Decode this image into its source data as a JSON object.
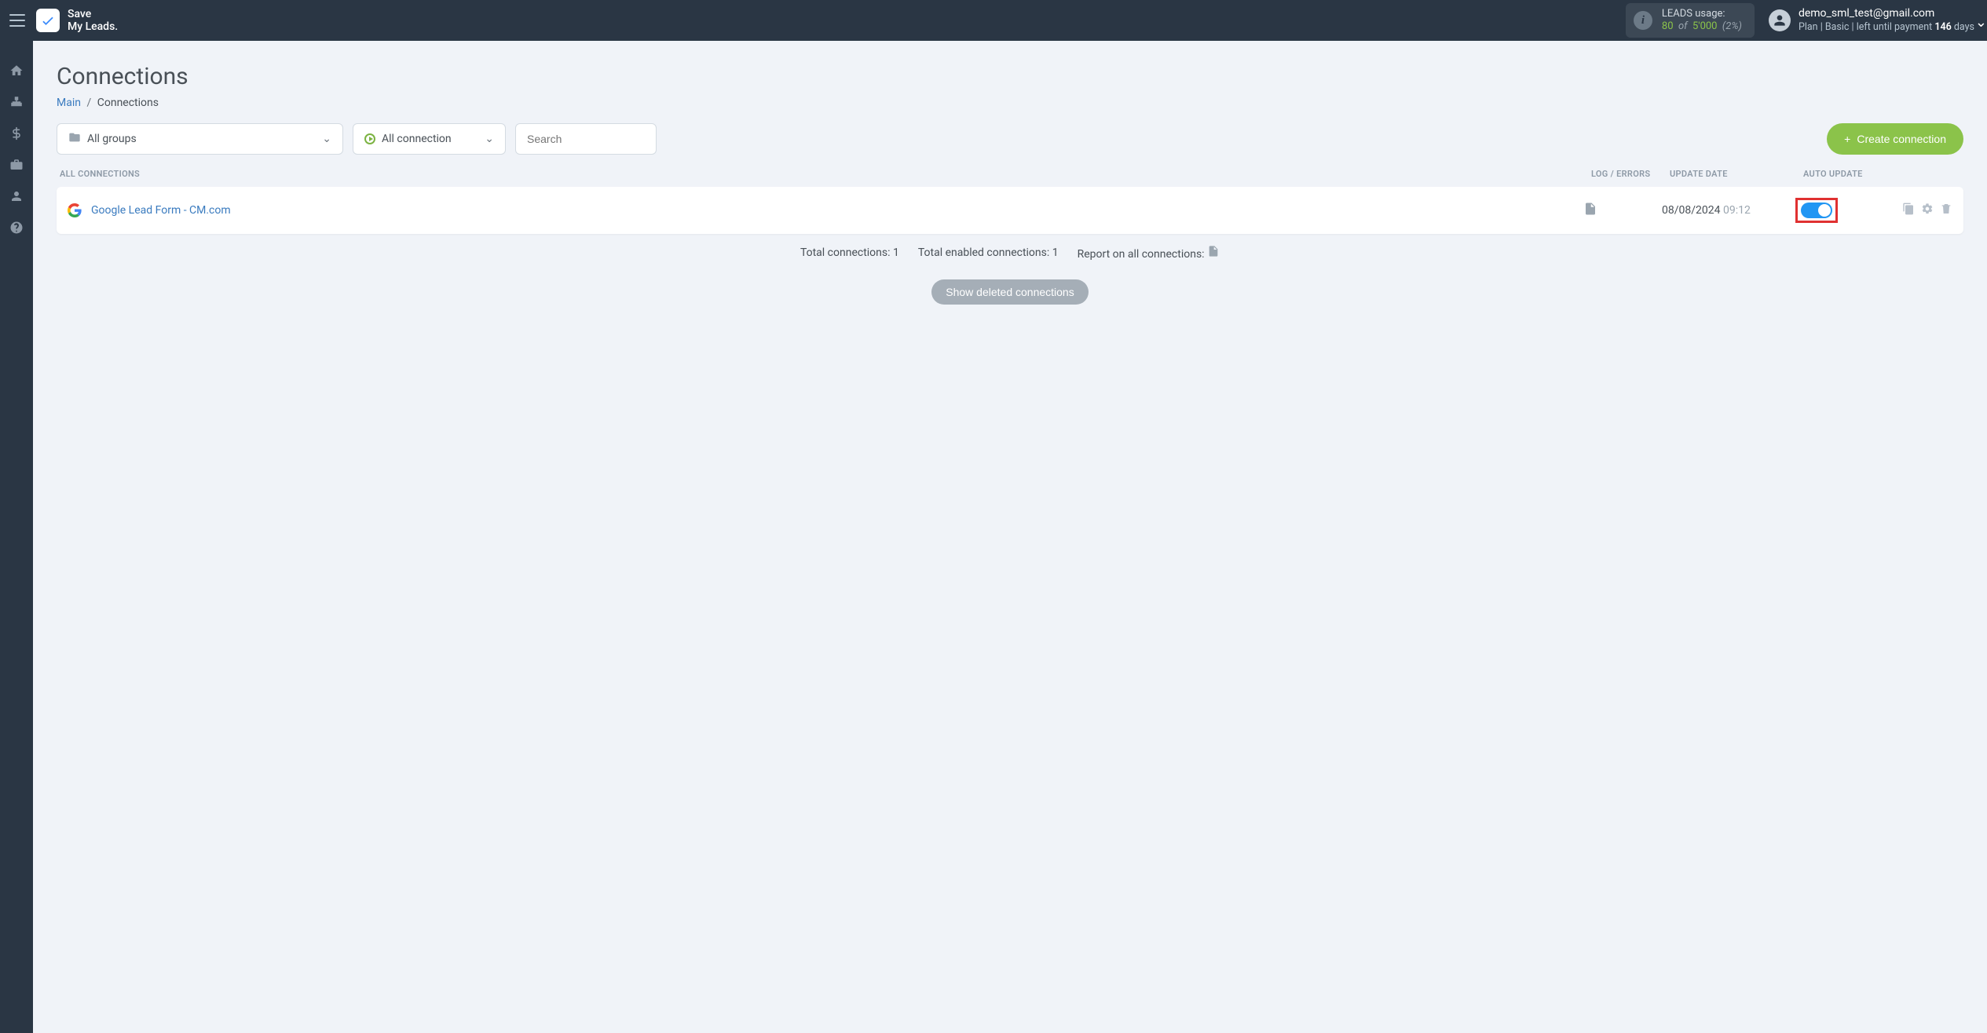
{
  "app": {
    "logo_line1": "Save",
    "logo_line2": "My Leads."
  },
  "usage": {
    "label": "LEADS usage:",
    "used": "80",
    "of": "of",
    "total": "5'000",
    "pct": "(2%)"
  },
  "user": {
    "email": "demo_sml_test@gmail.com",
    "plan_prefix": "Plan ",
    "plan_name": "| Basic |",
    "plan_mid": " left until payment ",
    "plan_days": "146",
    "plan_suffix": " days"
  },
  "page": {
    "title": "Connections"
  },
  "breadcrumb": {
    "main": "Main",
    "sep": "/",
    "current": "Connections"
  },
  "filters": {
    "groups_label": "All groups",
    "conn_label": "All connection",
    "search_placeholder": "Search"
  },
  "create_btn": "Create connection",
  "headers": {
    "all": "ALL CONNECTIONS",
    "log": "LOG / ERRORS",
    "date": "UPDATE DATE",
    "auto": "AUTO UPDATE"
  },
  "rows": [
    {
      "name": "Google Lead Form - CM.com",
      "date": "08/08/2024",
      "time": "09:12",
      "auto_on": true
    }
  ],
  "summary": {
    "total": "Total connections: 1",
    "enabled": "Total enabled connections: 1",
    "report": "Report on all connections:"
  },
  "show_deleted": "Show deleted connections"
}
